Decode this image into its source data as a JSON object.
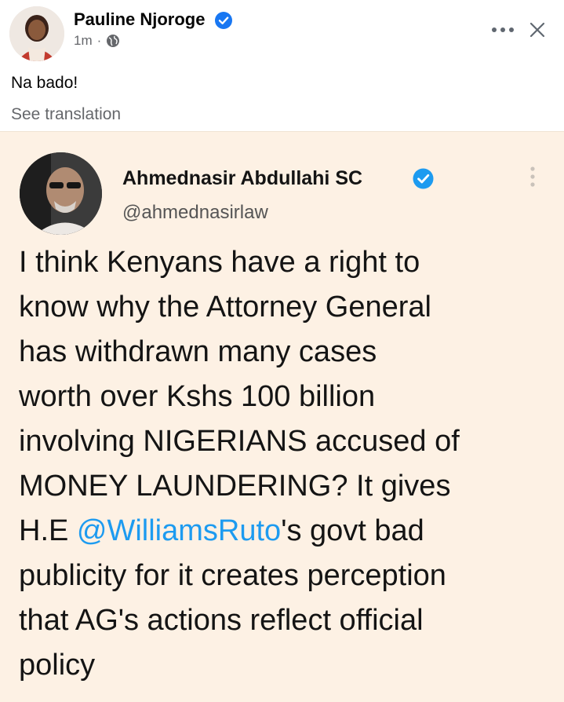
{
  "post": {
    "author": "Pauline Njoroge",
    "time": "1m",
    "separator": "·",
    "text": "Na bado!",
    "see_translation": "See translation"
  },
  "tweet": {
    "name": "Ahmednasir Abdullahi SC",
    "handle": "@ahmednasirlaw",
    "lines": [
      {
        "text": "I think Kenyans have a right to"
      },
      {
        "text": "know why the Attorney General"
      },
      {
        "text": "has withdrawn many cases"
      },
      {
        "text": "worth over Kshs 100 billion"
      },
      {
        "text": "involving NIGERIANS accused of"
      },
      {
        "text": "MONEY LAUNDERING? It gives"
      },
      {
        "pre": "H.E ",
        "mention": "@WilliamsRuto",
        "post": "'s govt bad"
      },
      {
        "text": "publicity for it creates perception"
      },
      {
        "text": "that AG's actions reflect official"
      },
      {
        "text": "policy"
      }
    ]
  },
  "colors": {
    "verified_blue": "#1877f2",
    "mention_blue": "#1d9bf0",
    "card_background": "#fdf1e4",
    "secondary_text": "#65676b"
  },
  "icons": [
    "verified-badge-icon",
    "globe-icon",
    "more-options-icon",
    "close-icon"
  ]
}
